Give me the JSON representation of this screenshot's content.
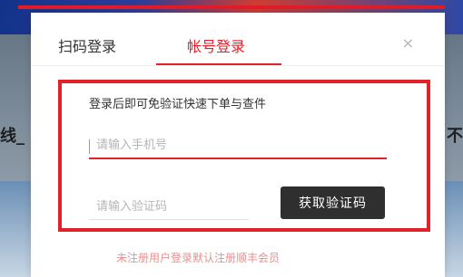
{
  "background": {
    "fragment_left": "线_",
    "fragment_right": "不"
  },
  "tabs": [
    {
      "label": "扫码登录"
    },
    {
      "label": "帐号登录"
    }
  ],
  "close_icon": "×",
  "form": {
    "hint": "登录后即可免验证快速下单与查件",
    "phone_placeholder": "请输入手机号",
    "code_placeholder": "请输入验证码",
    "get_code_label": "获取验证码"
  },
  "notice": "未注册用户登录默认注册顺丰会员",
  "colors": {
    "accent": "#e3212a",
    "button_bg": "#2f2f2f",
    "notice": "#e88f8f"
  }
}
